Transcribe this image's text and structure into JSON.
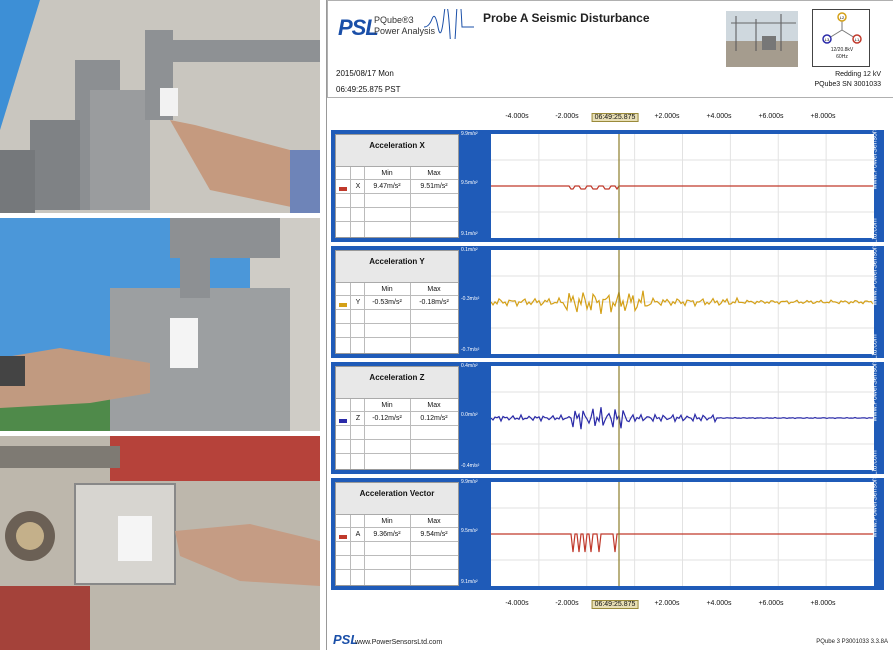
{
  "report": {
    "title": "Probe A Seismic Disturbance",
    "logo_text": "PSL",
    "product": "PQube®3",
    "product_sub": "Power Analysis",
    "date": "2015/08/17 Mon",
    "time": "06:49:25.875 PST",
    "location": "Redding 12 kV",
    "device": "PQube3 SN 3001033",
    "phasor_voltage": "12/20.8kV",
    "phasor_freq": "60Hz",
    "phasor_labels": [
      "L2",
      "L3",
      "L1"
    ]
  },
  "axis": {
    "ticks": [
      "-4.000s",
      "-2.000s",
      "06:49:25.875",
      "+2.000s",
      "+4.000s",
      "+6.000s",
      "+8.000s"
    ]
  },
  "table_headers": {
    "min": "Min",
    "max": "Max"
  },
  "side_text": "www.PowerSensorsLtd.com",
  "channels": [
    {
      "title": "Acceleration X",
      "axis": "X",
      "min": "9.47m/s²",
      "max": "9.51m/s²",
      "color": "#c0392b",
      "ylabels": [
        "9.9m/s²",
        "9.5m/s²",
        "9.1m/s²"
      ]
    },
    {
      "title": "Acceleration Y",
      "axis": "Y",
      "min": "-0.53m/s²",
      "max": "-0.18m/s²",
      "color": "#d4a017",
      "ylabels": [
        "0.1m/s²",
        "-0.3m/s²",
        "-0.7m/s²"
      ]
    },
    {
      "title": "Acceleration Z",
      "axis": "Z",
      "min": "-0.12m/s²",
      "max": "0.12m/s²",
      "color": "#2a2aa8",
      "ylabels": [
        "0.4m/s²",
        "0.0m/s²",
        "-0.4m/s²"
      ]
    },
    {
      "title": "Acceleration Vector",
      "axis": "A",
      "min": "9.36m/s²",
      "max": "9.54m/s²",
      "color": "#c0392b",
      "ylabels": [
        "9.9m/s²",
        "9.5m/s²",
        "9.1m/s²"
      ]
    }
  ],
  "footer": {
    "logo": "PSL",
    "url": "www.PowerSensorsLtd.com",
    "right": "PQube 3   P3001033  3.3.8A"
  },
  "colors": {
    "panel_blue": "#1f5bb8",
    "cursor": "#8b7d2a"
  }
}
